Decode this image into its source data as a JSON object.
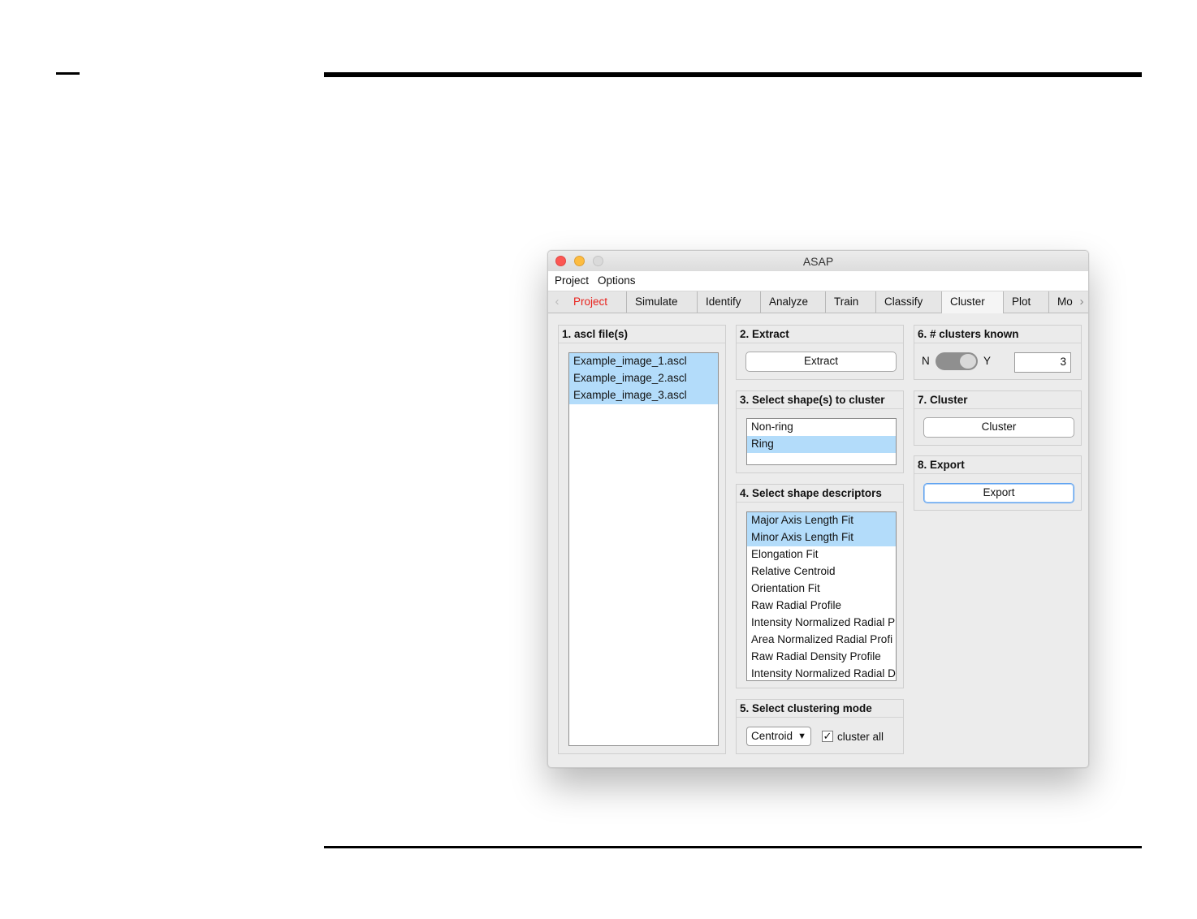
{
  "window": {
    "title": "ASAP"
  },
  "menu": [
    "Project",
    "Options"
  ],
  "tabs": [
    "Project",
    "Simulate",
    "Identify",
    "Analyze",
    "Train",
    "Classify",
    "Cluster",
    "Plot",
    "Mo"
  ],
  "active_tab": "Cluster",
  "panel1": {
    "title": "1. ascl file(s)",
    "files": [
      "Example_image_1.ascl",
      "Example_image_2.ascl",
      "Example_image_3.ascl"
    ]
  },
  "panel2": {
    "title": "2. Extract",
    "button": "Extract"
  },
  "panel3": {
    "title": "3. Select shape(s) to cluster",
    "items": [
      "Non-ring",
      "Ring"
    ]
  },
  "panel4": {
    "title": "4. Select shape descriptors",
    "items": [
      "Major Axis Length Fit",
      "Minor Axis Length Fit",
      "Elongation Fit",
      "Relative Centroid",
      "Orientation Fit",
      "Raw Radial Profile",
      "Intensity Normalized Radial P",
      "Area Normalized Radial Profi",
      "Raw Radial Density Profile",
      "Intensity Normalized Radial D"
    ]
  },
  "panel5": {
    "title": "5. Select clustering mode",
    "mode": "Centroid",
    "checkbox_label": "cluster all",
    "checkbox_checked": true
  },
  "panel6": {
    "title": "6. # clusters known",
    "left_label": "N",
    "right_label": "Y",
    "value": "3"
  },
  "panel7": {
    "title": "7. Cluster",
    "button": "Cluster"
  },
  "panel8": {
    "title": "8. Export",
    "button": "Export"
  },
  "colors": {
    "selection": "#b3dcfa",
    "tab_red": "#e8231d",
    "focus_blue": "#5ea2f1"
  }
}
